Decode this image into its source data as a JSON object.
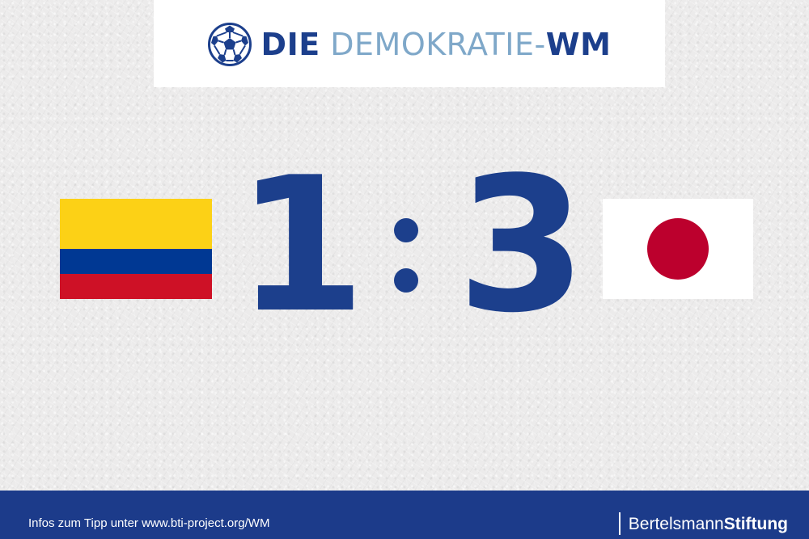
{
  "header": {
    "title_part1": "DIE",
    "title_part2": " DEMOKRATIE-",
    "title_part3": "WM",
    "icon": "soccer-ball-icon"
  },
  "match": {
    "home_flag": "Colombia flag",
    "away_flag": "Japan flag",
    "home_score": "1",
    "away_score": "3"
  },
  "footer": {
    "info_text": "Infos zum Tipp unter www.bti-project.org/WM",
    "brand_part1": "Bertelsmann",
    "brand_part2": "Stiftung"
  },
  "colors": {
    "brand_blue": "#1c3f8c",
    "title_light_blue": "#7fa8c9",
    "colombia_yellow": "#fcd116",
    "colombia_blue": "#003893",
    "colombia_red": "#ce1126",
    "japan_red": "#bc002d",
    "footer_blue": "#1c3b8a"
  }
}
